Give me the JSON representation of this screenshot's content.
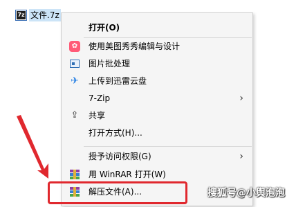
{
  "desktop": {
    "file_name": "文件.7z",
    "file_icon_text": "7z"
  },
  "menu": {
    "items": [
      {
        "label": "打开(O)",
        "icon": "none",
        "bold": true
      },
      {
        "label": "使用美图秀秀编辑与设计",
        "icon": "meitu-icon"
      },
      {
        "label": "图片批处理",
        "icon": "batch-image-icon"
      },
      {
        "label": "上传到迅雷云盘",
        "icon": "xunlei-icon"
      },
      {
        "label": "7-Zip",
        "icon": "none",
        "submenu": true
      },
      {
        "label": "共享",
        "icon": "share-icon"
      },
      {
        "label": "打开方式(H)...",
        "icon": "none"
      },
      {
        "label": "授予访问权限(G)",
        "icon": "none",
        "submenu": true
      },
      {
        "label": "用 WinRAR 打开(W)",
        "icon": "winrar-icon"
      },
      {
        "label": "解压文件(A)...",
        "icon": "winrar-icon",
        "highlighted_box": true
      }
    ],
    "arrow_glyph": "›",
    "meitu_glyph": "✿",
    "xunlei_glyph": "✈",
    "share_glyph": "⇪"
  },
  "annotation": {
    "color": "#e0282e",
    "target": "解压文件(A)..."
  },
  "watermark": "搜狐号@小舆泡泡"
}
